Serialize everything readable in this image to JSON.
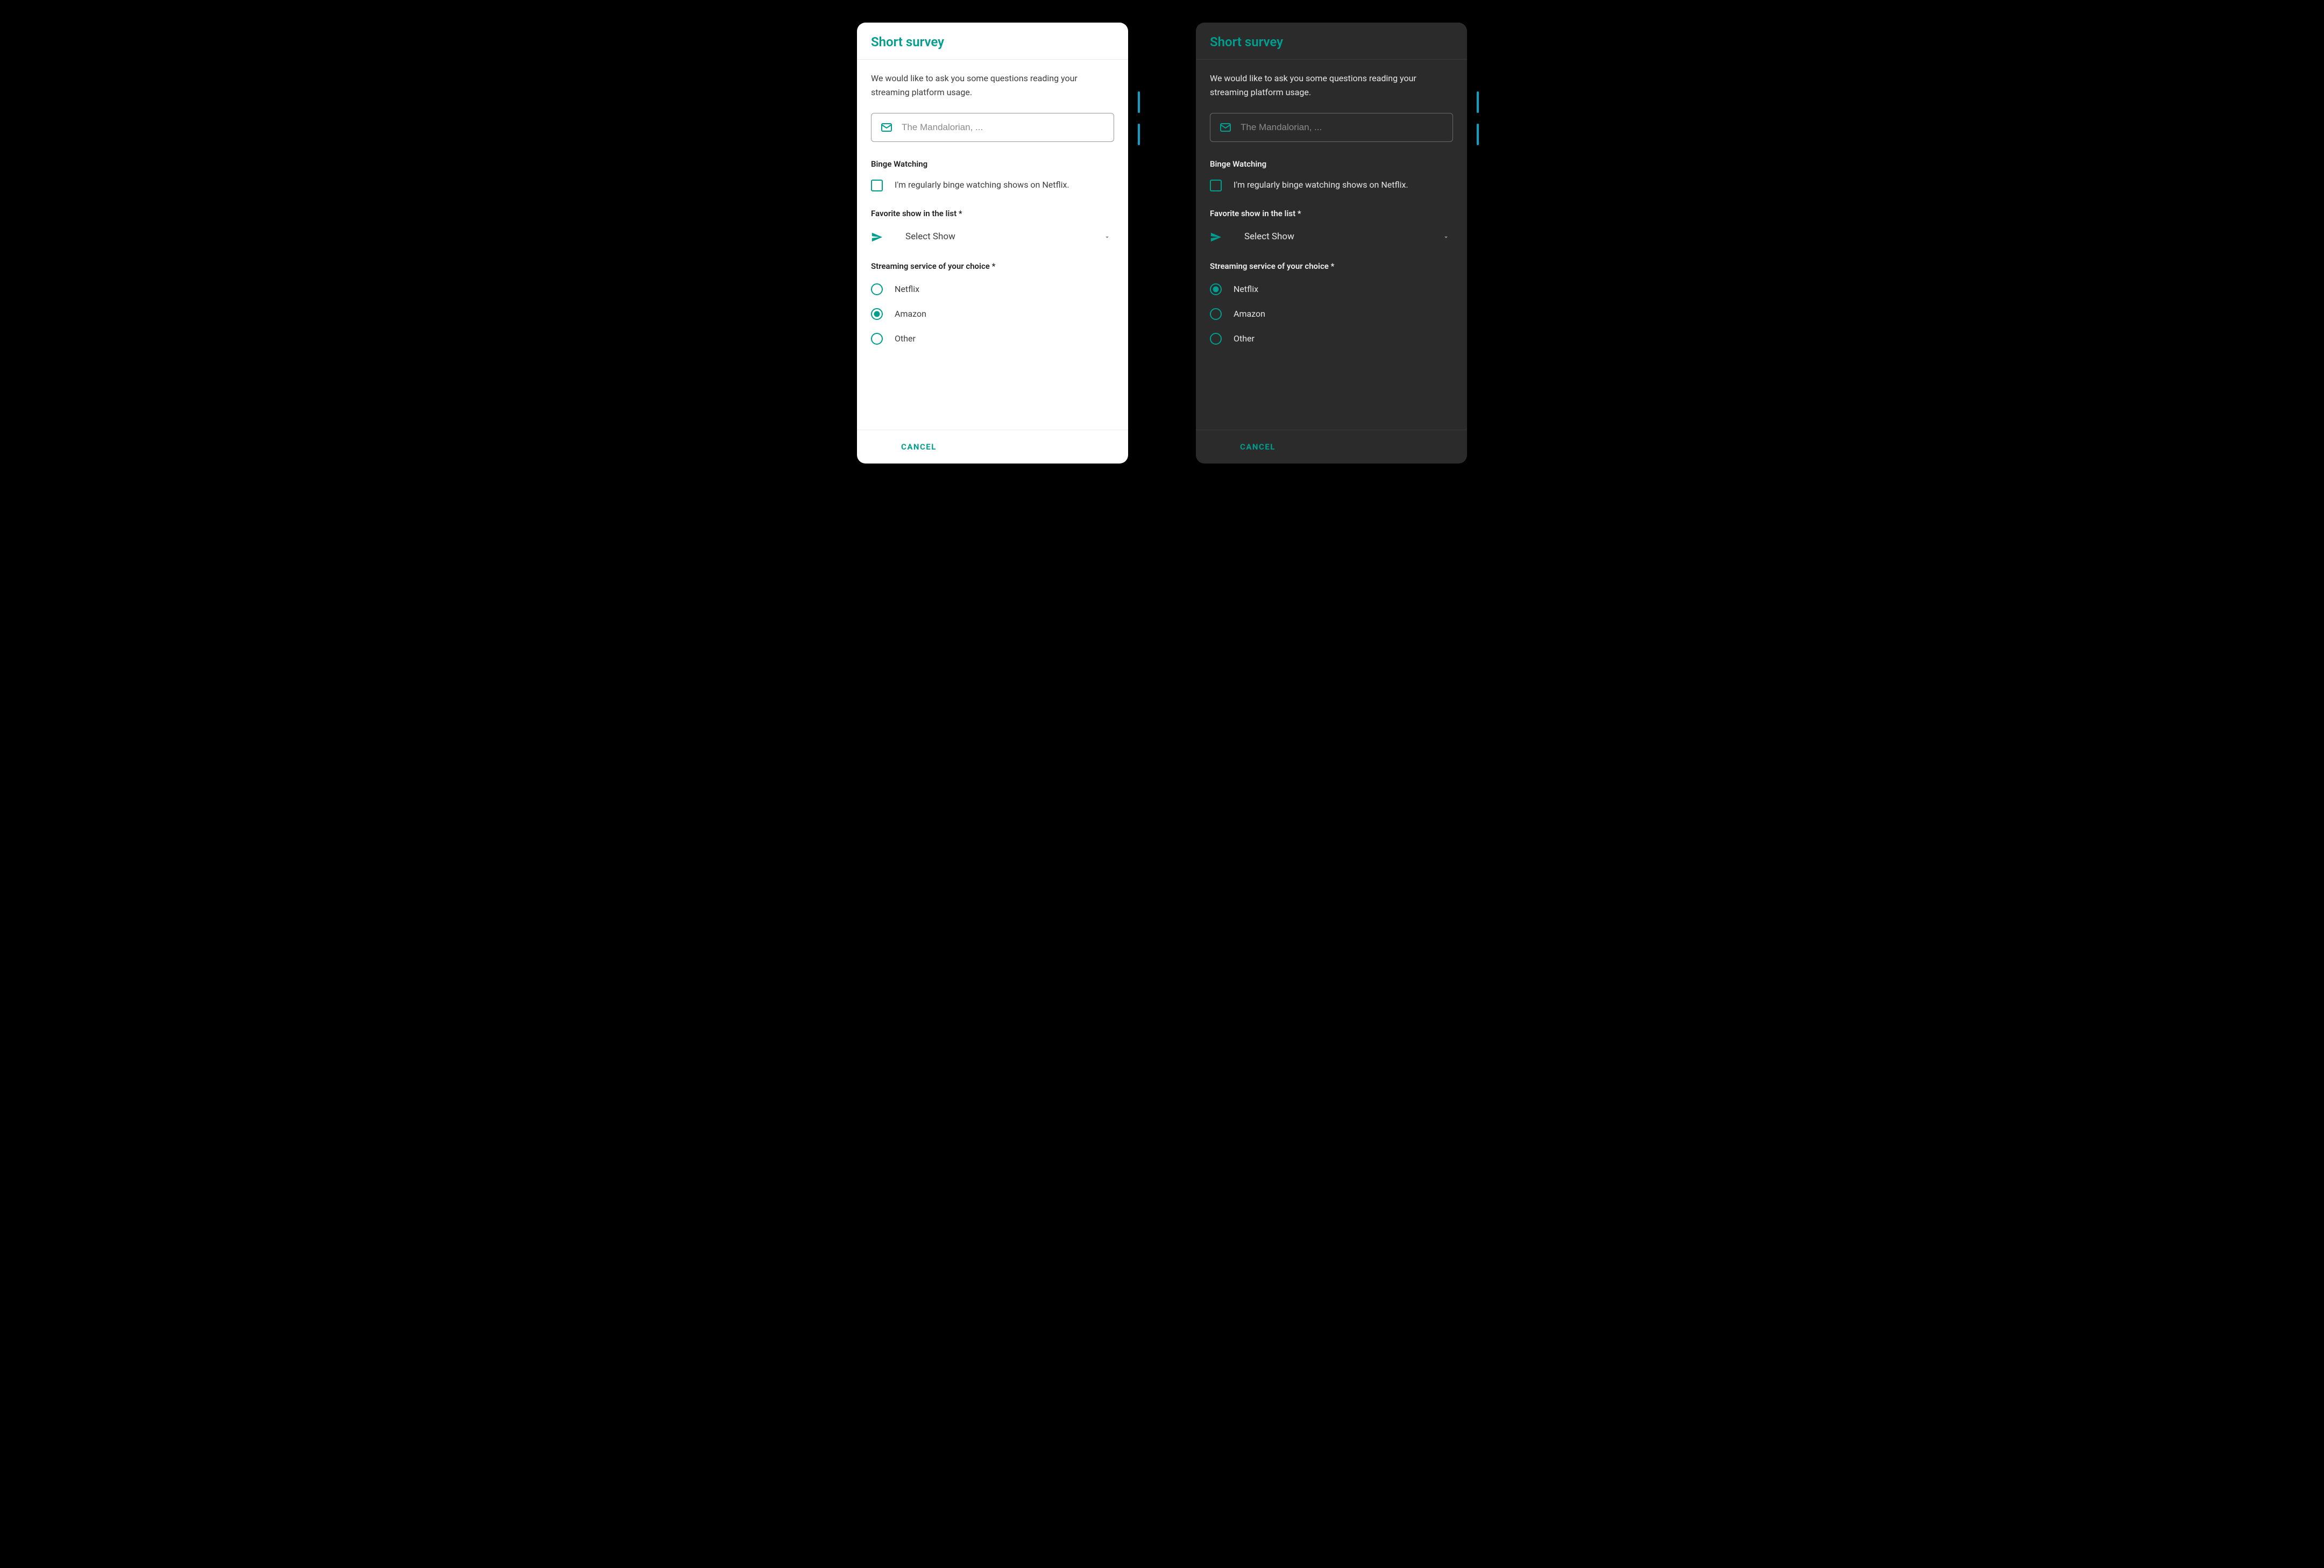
{
  "dialog": {
    "title": "Short survey",
    "intro": "We would like to ask you some questions reading your streaming platform usage.",
    "textfield": {
      "placeholder": "The Mandalorian, ..."
    },
    "checkbox": {
      "section_label": "Binge Watching",
      "label": "I'm regularly binge watching shows on Netflix."
    },
    "select": {
      "section_label": "Favorite show in the list *",
      "value": "Select Show"
    },
    "radio": {
      "section_label": "Streaming service of your choice *",
      "options": [
        "Netflix",
        "Amazon",
        "Other"
      ]
    },
    "footer": {
      "cancel": "CANCEL"
    }
  },
  "variants": {
    "light": {
      "selected_radio_index": 1
    },
    "dark": {
      "selected_radio_index": 0
    }
  }
}
